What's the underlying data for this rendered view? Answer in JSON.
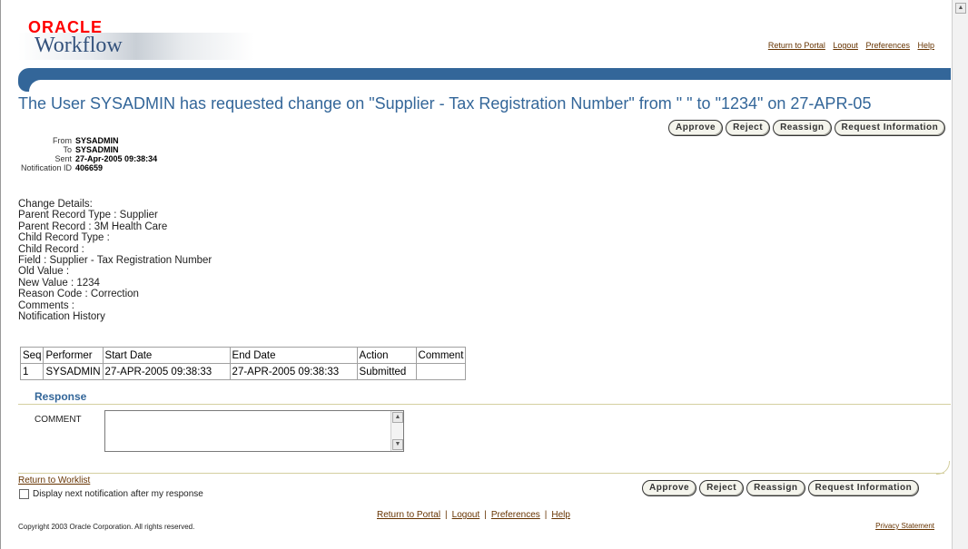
{
  "brand": {
    "oracle": "ORACLE",
    "product": "Workflow"
  },
  "global_nav": [
    "Return to Portal",
    "Logout",
    "Preferences",
    "Help"
  ],
  "page_title": "The User SYSADMIN has requested change on \"Supplier - Tax Registration Number\" from \" \" to \"1234\" on 27-APR-05",
  "actions": {
    "approve": "Approve",
    "reject": "Reject",
    "reassign": "Reassign",
    "request_info": "Request Information"
  },
  "header_fields": [
    {
      "label": "From",
      "value": "SYSADMIN"
    },
    {
      "label": "To",
      "value": "SYSADMIN"
    },
    {
      "label": "Sent",
      "value": "27-Apr-2005 09:38:34"
    },
    {
      "label": "Notification ID",
      "value": "406659"
    }
  ],
  "details": [
    "Change Details:",
    "Parent Record Type : Supplier",
    "Parent Record : 3M Health Care",
    "Child Record Type :",
    "Child Record :",
    "Field : Supplier - Tax Registration Number",
    "Old Value :",
    "New Value : 1234",
    "Reason Code : Correction",
    "Comments :",
    "Notification History"
  ],
  "history": {
    "columns": [
      "Seq",
      "Performer",
      "Start Date",
      "End Date",
      "Action",
      "Comment"
    ],
    "rows": [
      [
        "1",
        "SYSADMIN",
        "27-APR-2005 09:38:33",
        "27-APR-2005 09:38:33",
        "Submitted",
        ""
      ]
    ]
  },
  "response": {
    "heading": "Response",
    "comment_label": "COMMENT",
    "comment_value": ""
  },
  "return_worklist": "Return to Worklist",
  "display_next": "Display next notification after my response",
  "footer_nav": [
    "Return to Portal",
    "Logout",
    "Preferences",
    "Help"
  ],
  "copyright": "Copyright 2003 Oracle Corporation. All rights reserved.",
  "privacy": "Privacy Statement",
  "colors": {
    "brand_blue": "#336699",
    "link_brown": "#663300",
    "oracle_red": "#ff0000"
  }
}
